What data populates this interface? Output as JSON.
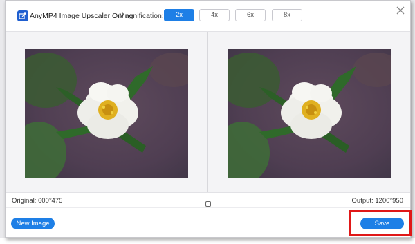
{
  "app": {
    "title": "AnyMP4 Image Upscaler Online",
    "logo_icon": "image-upscale-icon",
    "brand_color": "#1f5fd0"
  },
  "magnification": {
    "label": "Magnification:",
    "options": [
      "2x",
      "4x",
      "6x",
      "8x"
    ],
    "selected": "2x",
    "active_color": "#1e7fe6"
  },
  "close_icon": "close-icon",
  "panels": {
    "original_image": "flower-photo",
    "output_image": "flower-photo"
  },
  "status": {
    "original": "Original: 600*475",
    "output": "Output: 1200*950",
    "compare_icon": "square-icon"
  },
  "footer": {
    "new_image_label": "New Image",
    "save_label": "Save",
    "button_color": "#1e7fe6"
  },
  "annotation": {
    "highlight_color": "#e01818",
    "highlighted": "Save"
  }
}
